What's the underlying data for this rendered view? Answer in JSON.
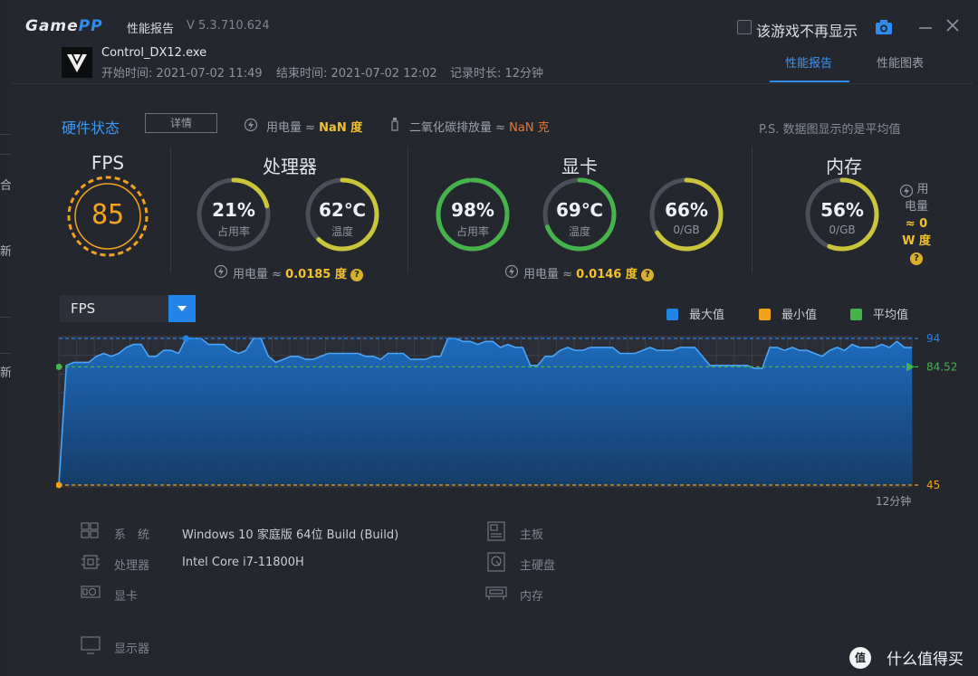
{
  "app": {
    "logo_left": "Game",
    "logo_right": "PP",
    "title": "性能报告",
    "version": "V 5.3.710.624",
    "hide_checkbox_label": "该游戏不再显示"
  },
  "session": {
    "exe": "Control_DX12.exe",
    "start": "开始时间: 2021-07-02 11:49",
    "end": "结束时间: 2021-07-02 12:02",
    "duration": "记录时长: 12分钟"
  },
  "tabs": [
    {
      "label": "性能报告",
      "active": true
    },
    {
      "label": "性能图表",
      "active": false
    }
  ],
  "hardware": {
    "title": "硬件状态",
    "detail_button": "详情",
    "power_label": "用电量 ≈",
    "power_value": "NaN 度",
    "co2_label": "二氧化碳排放量 ≈",
    "co2_value": "NaN 克",
    "ps_note": "P.S. 数据图显示的是平均值"
  },
  "fps": {
    "title": "FPS",
    "value": "85"
  },
  "cpu": {
    "title": "处理器",
    "usage": {
      "value": "21%",
      "label": "占用率",
      "pct": 0.21,
      "color": "#c9c43a"
    },
    "temp": {
      "value": "62℃",
      "label": "温度",
      "pct": 0.62,
      "color": "#c9c43a"
    },
    "power_label": "用电量 ≈",
    "power_value": "0.0185 度"
  },
  "gpu": {
    "title": "显卡",
    "usage": {
      "value": "98%",
      "label": "占用率",
      "pct": 0.98,
      "color": "#45b34a"
    },
    "temp": {
      "value": "69℃",
      "label": "温度",
      "pct": 0.69,
      "color": "#45b34a"
    },
    "vram": {
      "value": "66%",
      "label": "0/GB",
      "pct": 0.66,
      "color": "#c9c43a"
    },
    "power_label": "用电量 ≈",
    "power_value": "0.0146 度"
  },
  "memory": {
    "title": "内存",
    "usage": {
      "value": "56%",
      "label": "0/GB",
      "pct": 0.56,
      "color": "#c9c43a"
    },
    "power_l1": "用",
    "power_l2": "电量",
    "power_l3": "≈ 0",
    "power_l4": "W 度"
  },
  "chart_select": {
    "value": "FPS"
  },
  "legend": [
    {
      "label": "最大值",
      "color": "#2384e8"
    },
    {
      "label": "最小值",
      "color": "#f0a21c"
    },
    {
      "label": "平均值",
      "color": "#45b34a"
    }
  ],
  "chart_data": {
    "type": "area",
    "metric": "FPS",
    "max": 94,
    "min": 45,
    "avg": 84.52,
    "ylim": [
      45,
      94
    ],
    "x_end_label": "12分钟",
    "values": [
      45,
      85,
      86,
      86,
      86,
      88,
      89,
      88,
      89,
      91,
      92,
      92,
      88,
      88,
      90,
      90,
      89,
      94,
      94,
      94,
      92,
      92,
      92,
      90,
      89,
      90,
      94,
      94,
      88,
      86,
      87,
      88,
      88,
      87,
      87,
      88,
      89,
      89,
      89,
      89,
      89,
      88,
      88,
      87,
      89,
      89,
      89,
      87,
      87,
      87,
      88,
      88,
      94,
      94,
      93,
      93,
      92,
      93,
      93,
      91,
      92,
      91,
      91,
      85,
      85,
      88,
      88,
      90,
      91,
      90,
      90,
      91,
      91,
      91,
      91,
      89,
      89,
      89,
      90,
      91,
      90,
      90,
      90,
      91,
      91,
      91,
      88,
      85,
      85,
      85,
      85,
      85,
      85,
      84,
      84,
      91,
      91,
      90,
      91,
      90,
      90,
      89,
      88,
      90,
      91,
      90,
      92,
      91,
      91,
      91,
      92,
      91,
      93,
      91,
      91
    ]
  },
  "system": {
    "os_label": "系　统",
    "os_value": "Windows 10 家庭版 64位   Build (Build)",
    "cpu_label": "处理器",
    "cpu_value": "Intel Core i7-11800H",
    "gpu_label": "显卡",
    "monitor_label": "显示器",
    "board_label": "主板",
    "disk_label": "主硬盘",
    "ram_label": "内存"
  },
  "watermark": {
    "logo": "值",
    "text": "什么值得买"
  },
  "bg_side": {
    "t1": "合",
    "t2": "新",
    "t3": "新"
  }
}
